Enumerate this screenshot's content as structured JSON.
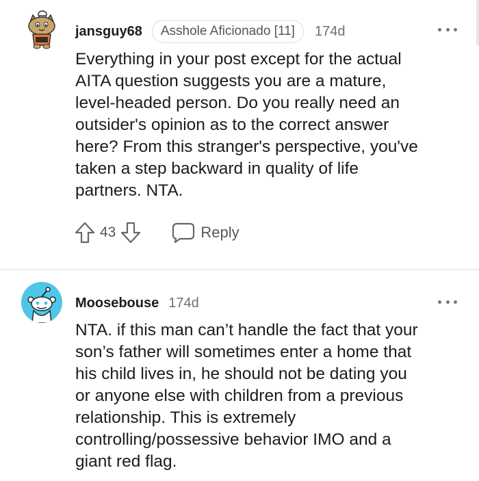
{
  "comments": [
    {
      "username": "jansguy68",
      "flair": "Asshole Aficionado [11]",
      "age": "174d",
      "body": "Everything in your post except for the actual\nAITA question suggests you are a mature,\nlevel-headed person. Do you really need an\noutsider's opinion as to the correct answer\nhere? From this stranger's perspective, you've\ntaken a step backward in quality of life\npartners. NTA.",
      "score": "43",
      "reply_label": "Reply",
      "avatar_icon": "cat-chef-avatar-icon"
    },
    {
      "username": "Moosebouse",
      "age": "174d",
      "body": "NTA. if this man can’t handle the fact that your\nson’s father will sometimes enter a home that\nhis child lives in, he should not be dating you\nor anyone else with children from a previous\nrelationship. This is extremely\ncontrolling/possessive behavior IMO and a\ngiant red flag.",
      "avatar_icon": "default-snoo-avatar-icon",
      "avatar_color": "#4fc6e8"
    }
  ]
}
